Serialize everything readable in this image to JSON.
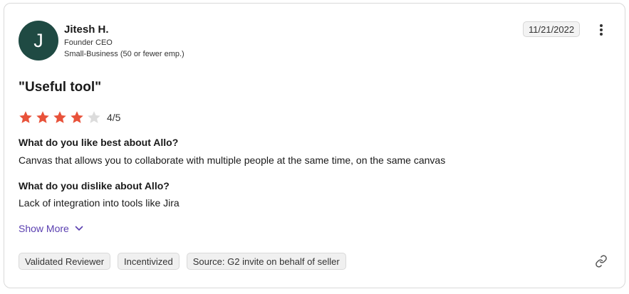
{
  "reviewer": {
    "avatar_initial": "J",
    "avatar_color": "#1f4a43",
    "name": "Jitesh H.",
    "title": "Founder CEO",
    "segment": "Small-Business (50 or fewer emp.)"
  },
  "review": {
    "date": "11/21/2022",
    "title": "\"Useful tool\"",
    "rating": 4,
    "rating_max": 5,
    "rating_text": "4/5",
    "star_color": "#e8523a",
    "star_empty_color": "#dcdcdc",
    "questions": [
      {
        "question": "What do you like best about Allo?",
        "answer": "Canvas that allows you to collaborate with multiple people at the same time, on the same canvas"
      },
      {
        "question": "What do you dislike about Allo?",
        "answer": "Lack of integration into tools like Jira"
      }
    ],
    "show_more_label": "Show More",
    "accent_color": "#5a3fb0"
  },
  "tags": [
    "Validated Reviewer",
    "Incentivized",
    "Source: G2 invite on behalf of seller"
  ],
  "icons": {
    "menu": "more-vertical-icon",
    "chevron": "chevron-down-icon",
    "link": "link-icon",
    "star": "star-icon"
  }
}
